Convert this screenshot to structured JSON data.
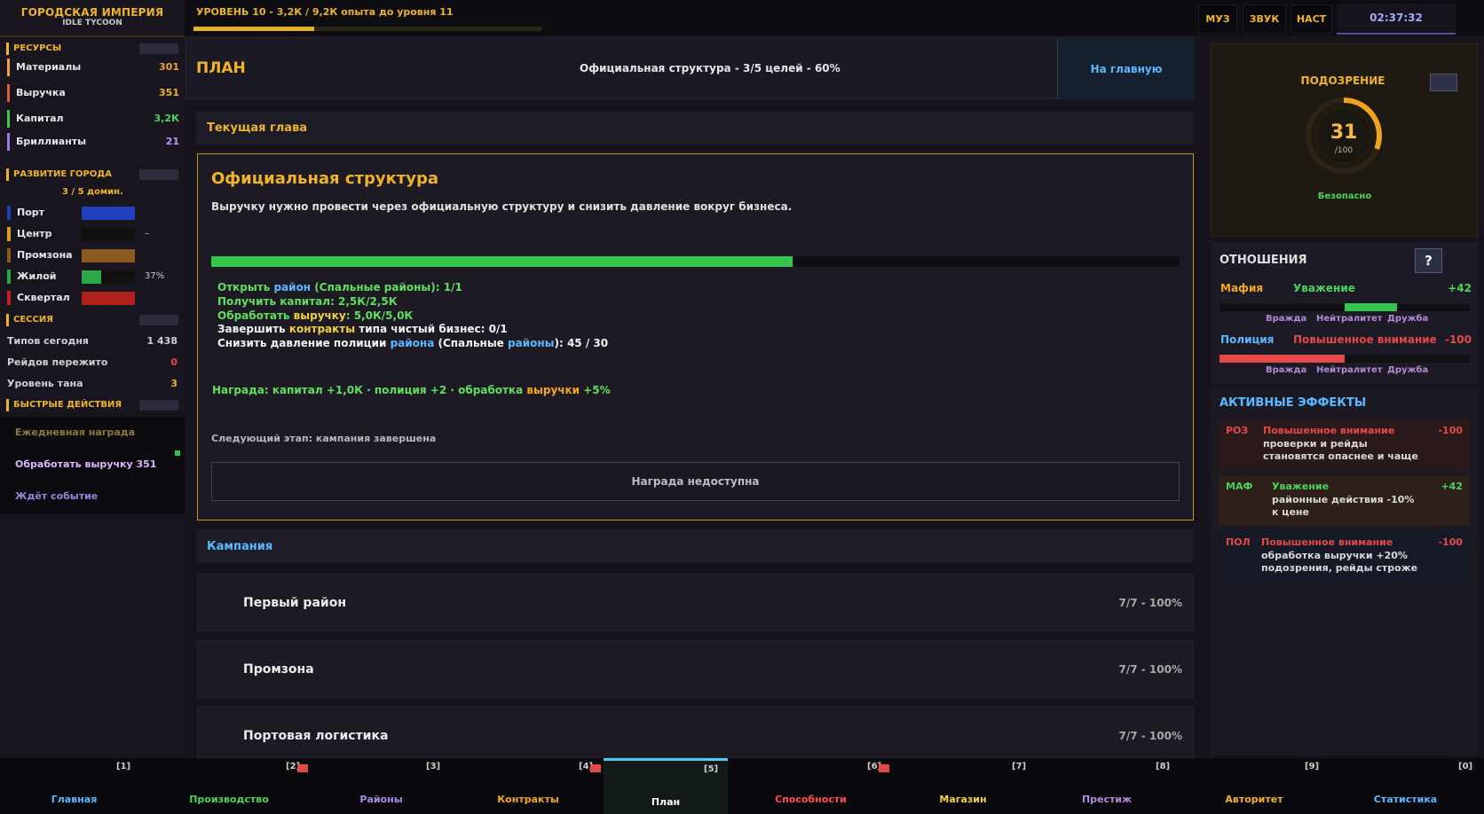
{
  "app": {
    "title": "ГОРОДСКАЯ ИМПЕРИЯ",
    "subtitle": "IDLE TYCOON"
  },
  "header": {
    "level_text": "УРОВЕНЬ 10 - 3,2К / 9,2К опыта до уровня 11",
    "xp_fraction": 0.348,
    "buttons": {
      "music": "МУЗ",
      "sound": "ЗВУК",
      "settings": "НАСТ"
    },
    "clock": "02:37:32"
  },
  "sidebar": {
    "resources_title": "РЕСУРСЫ",
    "resources": [
      {
        "label": "Материалы",
        "value": "301",
        "color": "#f0a23c"
      },
      {
        "label": "Выручка",
        "value": "351",
        "color": "#e05a3c"
      },
      {
        "label": "Капитал",
        "value": "3,2К",
        "color": "#3cc850"
      },
      {
        "label": "Бриллианты",
        "value": "21",
        "color": "#9a7ae0"
      }
    ],
    "city_title": "РАЗВИТИЕ ГОРОДА",
    "city_summary": "3 / 5 домин.",
    "districts": [
      {
        "label": "Порт",
        "color": "#2040c0",
        "fill": 1.0,
        "fill_color": "#2040c0",
        "pct": ""
      },
      {
        "label": "Центр",
        "color": "#d8a020",
        "fill": 0,
        "fill_color": "#111111",
        "pct": "–"
      },
      {
        "label": "Промзона",
        "color": "#8a5a20",
        "fill": 1.0,
        "fill_color": "#8a5a20",
        "pct": ""
      },
      {
        "label": "Жилой",
        "color": "#2aa84a",
        "fill": 0.37,
        "fill_color": "#2aa84a",
        "pct": "37%"
      },
      {
        "label": "Сквертал",
        "color": "#c02020",
        "fill": 1.0,
        "fill_color": "#b01e1e",
        "pct": ""
      }
    ],
    "session_title": "СЕССИЯ",
    "session": [
      {
        "label": "Типов сегодня",
        "value": "1 438",
        "color": "#d0d0d0"
      },
      {
        "label": "Рейдов пережито",
        "value": "0",
        "color": "#e54848"
      },
      {
        "label": "Уровень тана",
        "value": "3",
        "color": "#f0b429"
      }
    ],
    "quick_title": "БЫСТРЫЕ ДЕЙСТВИЯ",
    "quick_actions": [
      {
        "label": "Ежедневная награда",
        "color": "#8c7a3c"
      },
      {
        "label": "Обработать выручку 351",
        "color": "#d8b8ff"
      },
      {
        "label": "Ждёт событие",
        "color": "#8a8ae0"
      }
    ]
  },
  "plan": {
    "title": "ПЛАН",
    "summary": "Официальная структура - 3/5 целей - 60%",
    "home_button": "На главную",
    "current_chapter_label": "Текущая глава",
    "chapter": {
      "title": "Официальная структура",
      "description": "Выручку нужно провести через официальную структуру и снизить давление вокруг бизнеса.",
      "progress": 0.6,
      "goals": [
        {
          "a": "Открыть ",
          "b": "район",
          "c": " (Спальные районы): 1/1"
        },
        {
          "a": "Получить капитал: 2,5К/2,5К"
        },
        {
          "a": "Обработать ",
          "b": "выручку",
          "c": ": 5,0К/5,0К"
        },
        {
          "a": "Завершить ",
          "b": "контракты",
          "c": " типа чистый бизнес: 0/1"
        },
        {
          "a": "Снизить давление полиции ",
          "b": "района",
          "c": " (Спальные ",
          "d": "районы",
          "e": "): 45 / 30"
        }
      ],
      "reward_a": "Награда:  капитал +1,0К · полиция +2 · обработка ",
      "reward_b": "выручки",
      "reward_c": " +5%",
      "next_stage": "Следующий этап: кампания завершена",
      "reward_button": "Награда недоступна"
    },
    "campaign_label": "Кампания",
    "campaign": [
      {
        "name": "Первый район",
        "progress": "7/7 - 100%"
      },
      {
        "name": "Промзона",
        "progress": "7/7 - 100%"
      },
      {
        "name": "Портовая логистика",
        "progress": "7/7 - 100%"
      }
    ]
  },
  "suspicion": {
    "title": "ПОДОЗРЕНИЕ",
    "value": "31",
    "max": "/100",
    "fraction": 0.31,
    "status": "Безопасно"
  },
  "relations": {
    "title": "ОТНОШЕНИЯ",
    "help": "?",
    "factions": [
      {
        "name": "Мафия",
        "status": "Уважение",
        "value": "+42",
        "name_color": "#f5a623",
        "status_color": "#4ad45e",
        "value_color": "#4ad45e",
        "fill_color": "#34c64a",
        "fill_from": 0.5,
        "fill_to": 0.71,
        "labels": [
          "Вражда",
          "Нейтралитет",
          "Дружба"
        ]
      },
      {
        "name": "Полиция",
        "status": "Повышенное внимание",
        "value": "-100",
        "name_color": "#5ab8ff",
        "status_color": "#e54848",
        "value_color": "#e54848",
        "fill_color": "#e54848",
        "fill_from": 0.0,
        "fill_to": 0.5,
        "labels": [
          "Вражда",
          "Нейтралитет",
          "Дружба"
        ]
      }
    ]
  },
  "effects": {
    "title": "АКТИВНЫЕ ЭФФЕКТЫ",
    "items": [
      {
        "tag": "РОЗ",
        "name": "Повышенное внимание",
        "value": "-100",
        "line1": "проверки и рейды",
        "line2": "становятся опаснее и чаще",
        "tag_color": "#e54848",
        "name_color": "#e54848",
        "value_color": "#e54848",
        "bg": "#2b1a1c"
      },
      {
        "tag": "МАФ",
        "name": "Уважение",
        "value": "+42",
        "line1": "районные действия -10%",
        "line2": "к цене",
        "tag_color": "#4ad45e",
        "name_color": "#4ad45e",
        "value_color": "#4ad45e",
        "bg": "#2d1f1a"
      },
      {
        "tag": "ПОЛ",
        "name": "Повышенное внимание",
        "value": "-100",
        "line1": "обработка выручки +20%",
        "line2": "подозрения, рейды строже",
        "tag_color": "#e54848",
        "name_color": "#e54848",
        "value_color": "#e54848",
        "bg": "#151a26"
      }
    ]
  },
  "nav": [
    {
      "key": "[1]",
      "label": "Главная",
      "color": "#5ab8ff",
      "alert": false
    },
    {
      "key": "[2]",
      "label": "Производство",
      "color": "#4ad45e",
      "alert": true
    },
    {
      "key": "[3]",
      "label": "Районы",
      "color": "#a88ae8",
      "alert": false
    },
    {
      "key": "[4]",
      "label": "Контракты",
      "color": "#f5a623",
      "alert": true
    },
    {
      "key": "[5]",
      "label": "План",
      "color": "#ffffff",
      "alert": false,
      "active": true
    },
    {
      "key": "[6]",
      "label": "Способности",
      "color": "#ff4d4d",
      "alert": true
    },
    {
      "key": "[7]",
      "label": "Магазин",
      "color": "#f0d23c",
      "alert": false
    },
    {
      "key": "[8]",
      "label": "Престиж",
      "color": "#b48ad8",
      "alert": false
    },
    {
      "key": "[9]",
      "label": "Авторитет",
      "color": "#f0b429",
      "alert": false
    },
    {
      "key": "[0]",
      "label": "Статистика",
      "color": "#5ab8ff",
      "alert": false
    }
  ]
}
